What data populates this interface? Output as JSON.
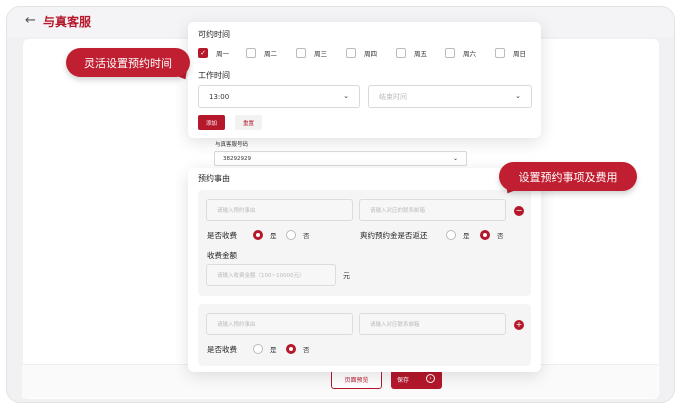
{
  "header": {
    "back_icon": "arrow-left-icon",
    "title": "与真客服"
  },
  "availability": {
    "title": "可约时间",
    "days": [
      {
        "label": "周一",
        "checked": true
      },
      {
        "label": "周二",
        "checked": false
      },
      {
        "label": "周三",
        "checked": false
      },
      {
        "label": "周四",
        "checked": false
      },
      {
        "label": "周五",
        "checked": false
      },
      {
        "label": "周六",
        "checked": false
      },
      {
        "label": "周日",
        "checked": false
      }
    ],
    "work_time_title": "工作时间",
    "start_time": "13:00",
    "end_time_placeholder": "结束时间",
    "add_label": "添加",
    "reset_label": "重置"
  },
  "callouts": {
    "flexible": "灵活设置预约时间",
    "items": "设置预约事项及费用"
  },
  "phone": {
    "label": "与真客服号码",
    "value": "38292929"
  },
  "reasons": {
    "title": "预约事由",
    "item_placeholder": "请输入预约事由",
    "email_placeholder": "请输入对应的联系邮箱",
    "charge_label": "是否收费",
    "yes": "是",
    "no": "否",
    "refund_label": "爽约预约金是否返还",
    "amount_label": "收费金额",
    "amount_placeholder": "请输入收费金额（100~10000元）",
    "unit": "元",
    "item2_placeholder": "请输入预约事由",
    "email2_placeholder": "请输入对应联系邮箱"
  },
  "footer": {
    "preview_label": "页面预览",
    "save_label": "保存"
  },
  "colors": {
    "accent": "#b5172b"
  }
}
